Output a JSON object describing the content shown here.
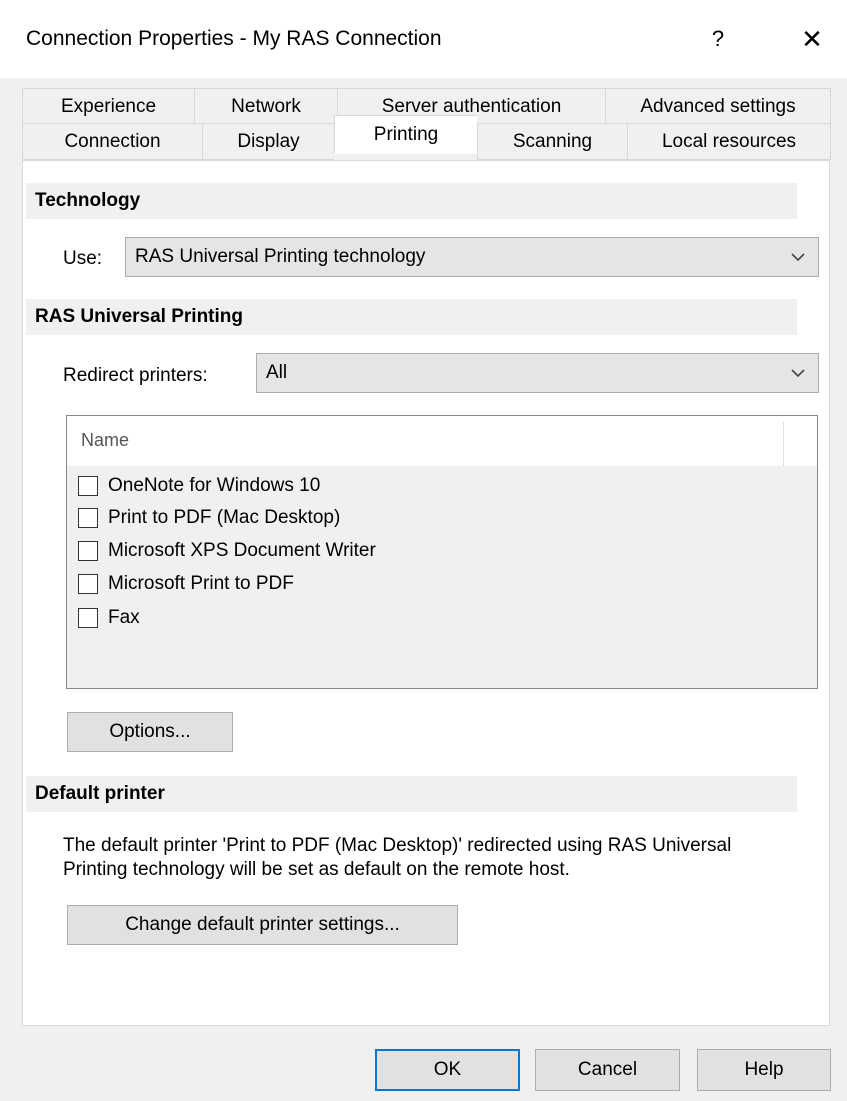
{
  "window": {
    "title": "Connection Properties - My RAS Connection",
    "help_label": "?",
    "close_label": "✕"
  },
  "tabs": {
    "back_row": [
      "Experience",
      "Network",
      "Server authentication",
      "Advanced settings"
    ],
    "front_row": [
      "Connection",
      "Display",
      "Printing",
      "Scanning",
      "Local resources"
    ],
    "active": "Printing"
  },
  "technology": {
    "header": "Technology",
    "use_label": "Use:",
    "use_value": "RAS Universal Printing technology"
  },
  "universal_printing": {
    "header": "RAS Universal Printing",
    "redirect_label": "Redirect printers:",
    "redirect_value": "All",
    "list_header": "Name",
    "printers": [
      {
        "name": "OneNote for Windows 10",
        "checked": false
      },
      {
        "name": "Print to PDF (Mac Desktop)",
        "checked": false
      },
      {
        "name": "Microsoft XPS Document Writer",
        "checked": false
      },
      {
        "name": "Microsoft Print to PDF",
        "checked": false
      },
      {
        "name": "Fax",
        "checked": false
      }
    ],
    "options_label": "Options..."
  },
  "default_printer": {
    "header": "Default printer",
    "description_line1": "The default printer 'Print to PDF (Mac Desktop)' redirected using RAS Universal",
    "description_line2": "Printing technology will be set as default on the remote host.",
    "change_label": "Change default printer settings..."
  },
  "footer": {
    "ok_label": "OK",
    "cancel_label": "Cancel",
    "help_label": "Help"
  },
  "colors": {
    "focus_border": "#0078d7",
    "dialog_bg": "#f0f0f0",
    "panel_bg": "#ffffff"
  },
  "icons": {
    "dropdown": "chevron-down-icon",
    "close": "close-icon",
    "help": "help-icon"
  }
}
